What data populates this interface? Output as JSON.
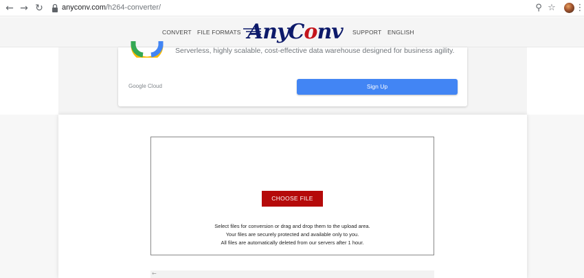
{
  "browser": {
    "url_host": "anyconv.com",
    "url_path": "/h264-converter/",
    "back_icon": "←",
    "forward_icon": "→",
    "reload_icon": "↻",
    "search_icon": "⚲",
    "star_icon": "☆",
    "menu_icon": "⋮"
  },
  "header": {
    "nav_convert": "CONVERT",
    "nav_formats": "FILE FORMATS",
    "logo_any": "Any",
    "logo_c": "C",
    "logo_o": "o",
    "logo_nv": "nv",
    "nav_support": "SUPPORT",
    "nav_language": "ENGLISH"
  },
  "ad": {
    "description": "Serverless, highly scalable, cost-effective data warehouse designed for business agility.",
    "brand": "Google Cloud",
    "signup_label": "Sign Up"
  },
  "upload": {
    "choose_label": "CHOOSE FILE",
    "line1": "Select files for conversion or drag and drop them to the upload area.",
    "line2": "Your files are securely protected and available only to you.",
    "line3": "All files are automatically deleted from our servers after 1 hour."
  },
  "colors": {
    "brand_red": "#b50a0a",
    "brand_navy": "#0d1a6a",
    "signup_blue": "#4285f4"
  }
}
